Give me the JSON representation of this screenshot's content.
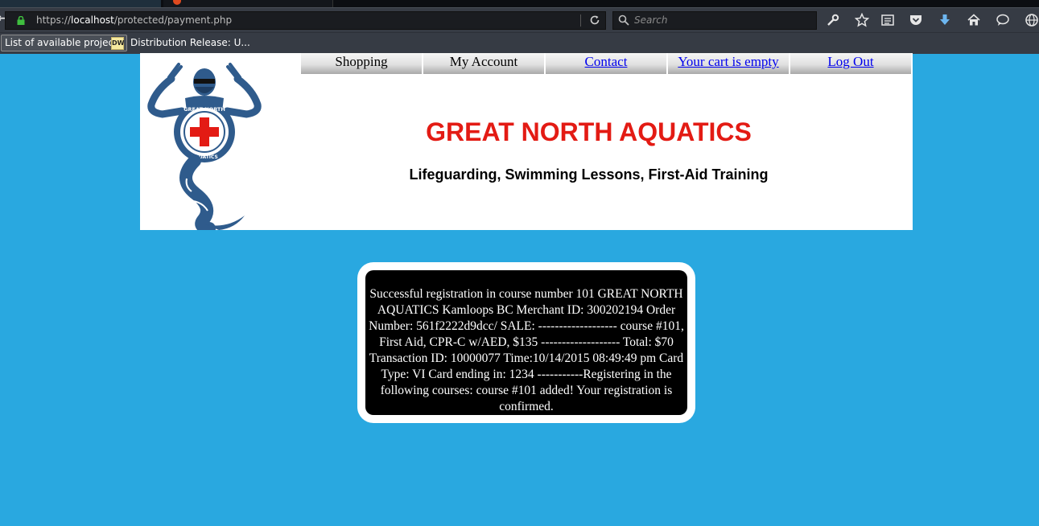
{
  "browser": {
    "url": {
      "host": "localhost",
      "path": "/protected/payment.php",
      "scheme": "https://"
    },
    "search_placeholder": "Search",
    "bookmarks": [
      {
        "label": "List of available projec..."
      },
      {
        "label": "Distribution Release: U...",
        "icon": "DW"
      }
    ]
  },
  "site": {
    "nav": [
      {
        "label": "Shopping"
      },
      {
        "label": "My Account"
      },
      {
        "label": "Contact"
      },
      {
        "label": "Your cart is empty"
      },
      {
        "label": "Log Out"
      }
    ],
    "title": "GREAT NORTH AQUATICS",
    "tagline": "Lifeguarding, Swimming Lessons, First-Aid Training",
    "logo": {
      "top_text": "GREAT NORTH",
      "bottom_text": "AQUATICS"
    }
  },
  "message": {
    "text": "Successful registration in course number 101 GREAT NORTH AQUATICS Kamloops BC Merchant ID: 300202194 Order Number: 561f2222d9dcc/ SALE: ------------------- course #101, First Aid, CPR-C w/AED, $135 ------------------- Total: $70 Transaction ID: 10000077 Time:10/14/2015 08:49:49 pm Card Type: VI Card ending in: 1234 -----------Registering in the following courses: course #101 added! Your registration is confirmed."
  },
  "colors": {
    "page_background": "#29a8e0",
    "title_red": "#e31b14",
    "logo_blue": "#2f5b8c"
  }
}
